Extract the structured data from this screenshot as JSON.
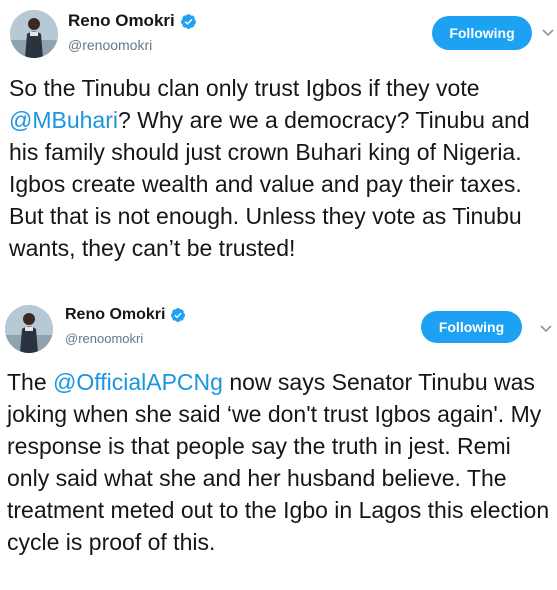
{
  "tweets": [
    {
      "author": {
        "name": "Reno Omokri",
        "handle": "@renoomokri",
        "verified": true,
        "avatar_icon": "user-avatar"
      },
      "follow_button_label": "Following",
      "text_before": "So the Tinubu clan only trust Igbos if they vote ",
      "mention": "@MBuhari",
      "text_after": "? Why are we a democracy? Tinubu and his family should just crown Buhari king of Nigeria. Igbos create wealth and value and pay their taxes. But that is not enough. Unless they vote as Tinubu wants, they can’t be trusted!"
    },
    {
      "author": {
        "name": "Reno Omokri",
        "handle": "@renoomokri",
        "verified": true,
        "avatar_icon": "user-avatar"
      },
      "follow_button_label": "Following",
      "text_before": "The ",
      "mention": "@OfficialAPCNg",
      "text_after": " now says Senator Tinubu was joking when she said ‘we don't trust Igbos again'. My response is that people say the truth in jest. Remi only said what she and her husband believe. The treatment meted out to the Igbo in Lagos this election cycle is proof of this."
    }
  ],
  "colors": {
    "accent": "#1da1f2",
    "mention": "#1b95e0",
    "text": "#14171a",
    "secondary_text": "#657786"
  }
}
